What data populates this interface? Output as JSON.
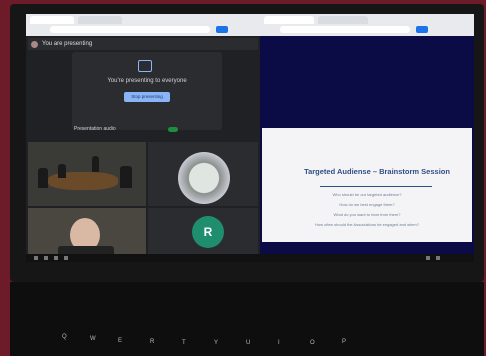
{
  "meet": {
    "banner": "You are presenting",
    "present_text": "You're presenting to everyone",
    "stop_label": "Stop presenting",
    "audio_label": "Presentation audio"
  },
  "tiles": {
    "avatar_letter": "R"
  },
  "slide": {
    "title": "Targeted Audiense – Brainstorm Session",
    "lines": [
      "Who should be our targeted audience?",
      "How do we best engage them?",
      "What do you want to hear from them?",
      "How often should the Associations be engaged and when?"
    ]
  },
  "keyboard": {
    "keys": [
      "Q",
      "W",
      "E",
      "R",
      "T",
      "Y",
      "U",
      "I",
      "O",
      "P"
    ]
  }
}
